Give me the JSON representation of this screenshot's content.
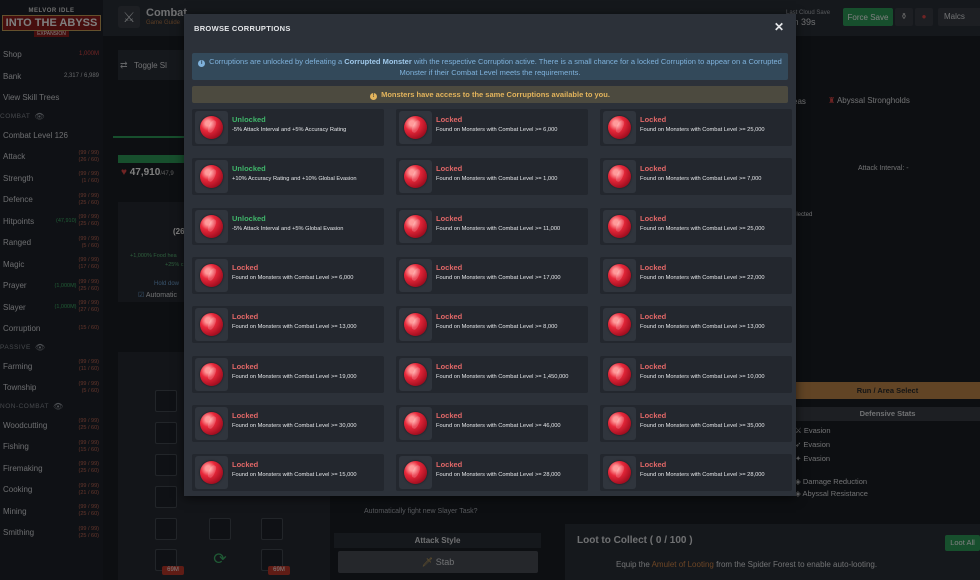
{
  "sidebar": {
    "logo": {
      "line1": "MELVOR IDLE",
      "line2": "INTO THE ABYSS",
      "line3": "EXPANSION"
    },
    "items": [
      {
        "label": "Shop",
        "value": "1,000M",
        "kind": "shop"
      },
      {
        "label": "Bank",
        "value": "2,317 / 6,989",
        "kind": "bank"
      },
      {
        "label": "View Skill Trees",
        "value": "",
        "kind": "plain"
      }
    ],
    "sections": [
      {
        "heading": "COMBAT",
        "items": [
          {
            "label": "Combat Level 126",
            "value": ""
          },
          {
            "label": "Attack",
            "value": "(99 / 99)\n(26 / 60)"
          },
          {
            "label": "Strength",
            "value": "(99 / 99)\n(1 / 60)"
          },
          {
            "label": "Defence",
            "value": "(99 / 99)\n(25 / 60)"
          },
          {
            "label": "Hitpoints",
            "value": "(99 / 99)\n(25 / 60)",
            "extra": "(47,910)"
          },
          {
            "label": "Ranged",
            "value": "(99 / 99)\n(5 / 60)"
          },
          {
            "label": "Magic",
            "value": "(99 / 99)\n(17 / 60)"
          },
          {
            "label": "Prayer",
            "value": "(99 / 99)\n(25 / 60)",
            "extra": "(1,000M)"
          },
          {
            "label": "Slayer",
            "value": "(99 / 99)\n(27 / 60)",
            "extra": "(1,000M)"
          },
          {
            "label": "Corruption",
            "value": "(15 / 60)"
          }
        ]
      },
      {
        "heading": "PASSIVE",
        "items": [
          {
            "label": "Farming",
            "value": "(99 / 99)\n(11 / 60)"
          },
          {
            "label": "Township",
            "value": "(99 / 99)\n(5 / 60)"
          }
        ]
      },
      {
        "heading": "NON-COMBAT",
        "items": [
          {
            "label": "Woodcutting",
            "value": "(99 / 99)\n(25 / 60)"
          },
          {
            "label": "Fishing",
            "value": "(99 / 99)\n(15 / 60)"
          },
          {
            "label": "Firemaking",
            "value": "(99 / 99)\n(25 / 60)"
          },
          {
            "label": "Cooking",
            "value": "(99 / 99)\n(21 / 60)"
          },
          {
            "label": "Mining",
            "value": "(99 / 99)\n(25 / 60)"
          },
          {
            "label": "Smithing",
            "value": "(99 / 99)\n(25 / 60)"
          }
        ]
      }
    ]
  },
  "topbar": {
    "title": "Combat",
    "subtitle": "Game Guide",
    "cloud_label": "Last Cloud Save",
    "cloud_time": "6m 39s",
    "force_save": "Force Save",
    "user": "Malcs"
  },
  "background": {
    "toggle_label": "Toggle Sl",
    "hp_value": "47,910",
    "hp_max": "/47,9",
    "food_count": "(26",
    "food_info_1": "+1,000% Food hea",
    "food_info_2": "+25% c",
    "hold_down": "Hold dow",
    "auto_eat": "Automatic",
    "eas": "eas",
    "abyssal": "Abyssal Strongholds",
    "attack_interval": "Attack Interval: -",
    "selected": "elected",
    "run_area": "Run / Area Select",
    "defensive_stats": "Defensive Stats",
    "evasions": [
      "Evasion",
      "Evasion",
      "Evasion"
    ],
    "damage_reduction": "Damage Reduction",
    "abyssal_resistance": "Abyssal Resistance",
    "auto_slayer": "Automatically fight new Slayer Task?",
    "attack_style": "Attack Style",
    "stab": "Stab",
    "loot_title": "Loot to Collect ( 0 / 100 )",
    "loot_all": "Loot All",
    "loot_desc_pre": "Equip the ",
    "loot_desc_link": "Amulet of Looting",
    "loot_desc_post": " from the Spider Forest to enable auto-looting.",
    "badge_69m": "69M"
  },
  "modal": {
    "title": "BROWSE CORRUPTIONS",
    "info_pre": "Corruptions are unlocked by defeating a ",
    "info_bold": "Corrupted Monster",
    "info_post": " with the respective Corruption active. There is a small chance for a locked Corruption to appear on a Corrupted Monster if their Combat Level meets the requirements.",
    "warning": "Monsters have access to the same Corruptions available to you.",
    "cards": [
      {
        "status": "Unlocked",
        "desc": "-5% Attack Interval and +5% Accuracy Rating"
      },
      {
        "status": "Locked",
        "desc": "Found on Monsters with Combat Level >= 6,000"
      },
      {
        "status": "Locked",
        "desc": "Found on Monsters with Combat Level >= 25,000"
      },
      {
        "status": "Unlocked",
        "desc": "+10% Accuracy Rating and +10% Global Evasion"
      },
      {
        "status": "Locked",
        "desc": "Found on Monsters with Combat Level >= 1,000"
      },
      {
        "status": "Locked",
        "desc": "Found on Monsters with Combat Level >= 7,000"
      },
      {
        "status": "Unlocked",
        "desc": "-5% Attack Interval and +5% Global Evasion"
      },
      {
        "status": "Locked",
        "desc": "Found on Monsters with Combat Level >= 11,000"
      },
      {
        "status": "Locked",
        "desc": "Found on Monsters with Combat Level >= 25,000"
      },
      {
        "status": "Locked",
        "desc": "Found on Monsters with Combat Level >= 6,000"
      },
      {
        "status": "Locked",
        "desc": "Found on Monsters with Combat Level >= 17,000"
      },
      {
        "status": "Locked",
        "desc": "Found on Monsters with Combat Level >= 22,000"
      },
      {
        "status": "Locked",
        "desc": "Found on Monsters with Combat Level >= 13,000"
      },
      {
        "status": "Locked",
        "desc": "Found on Monsters with Combat Level >= 8,000"
      },
      {
        "status": "Locked",
        "desc": "Found on Monsters with Combat Level >= 13,000"
      },
      {
        "status": "Locked",
        "desc": "Found on Monsters with Combat Level >= 19,000"
      },
      {
        "status": "Locked",
        "desc": "Found on Monsters with Combat Level >= 1,450,000"
      },
      {
        "status": "Locked",
        "desc": "Found on Monsters with Combat Level >= 10,000"
      },
      {
        "status": "Locked",
        "desc": "Found on Monsters with Combat Level >= 30,000"
      },
      {
        "status": "Locked",
        "desc": "Found on Monsters with Combat Level >= 46,000"
      },
      {
        "status": "Locked",
        "desc": "Found on Monsters with Combat Level >= 35,000"
      },
      {
        "status": "Locked",
        "desc": "Found on Monsters with Combat Level >= 15,000"
      },
      {
        "status": "Locked",
        "desc": "Found on Monsters with Combat Level >= 28,000"
      },
      {
        "status": "Locked",
        "desc": "Found on Monsters with Combat Level >= 28,000"
      }
    ]
  }
}
